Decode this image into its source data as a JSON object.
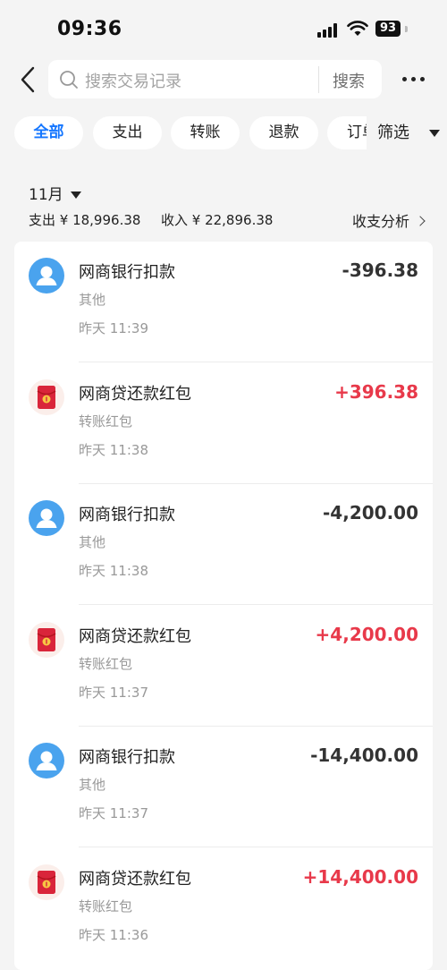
{
  "status_bar": {
    "time": "09:36",
    "battery": "93"
  },
  "header": {
    "search_placeholder": "搜索交易记录",
    "search_button": "搜索"
  },
  "tabs": [
    {
      "label": "全部",
      "active": true
    },
    {
      "label": "支出"
    },
    {
      "label": "转账"
    },
    {
      "label": "退款"
    },
    {
      "label": "订单"
    }
  ],
  "filter_label": "筛选",
  "summary": {
    "month": "11月",
    "expense": "支出 ¥ 18,996.38",
    "income": "收入 ¥ 22,896.38",
    "analysis": "收支分析"
  },
  "colors": {
    "accent": "#1677ff",
    "income": "#e8394a",
    "avatar_blue": "#4aa3ee",
    "envelope_red": "#d9253a"
  },
  "transactions": [
    {
      "title": "网商银行扣款",
      "category": "其他",
      "time": "昨天 11:39",
      "amount": "-396.38",
      "type": "expense",
      "icon": "person-avatar-icon"
    },
    {
      "title": "网商贷还款红包",
      "category": "转账红包",
      "time": "昨天 11:38",
      "amount": "+396.38",
      "type": "income",
      "icon": "red-envelope-icon"
    },
    {
      "title": "网商银行扣款",
      "category": "其他",
      "time": "昨天 11:38",
      "amount": "-4,200.00",
      "type": "expense",
      "icon": "person-avatar-icon"
    },
    {
      "title": "网商贷还款红包",
      "category": "转账红包",
      "time": "昨天 11:37",
      "amount": "+4,200.00",
      "type": "income",
      "icon": "red-envelope-icon"
    },
    {
      "title": "网商银行扣款",
      "category": "其他",
      "time": "昨天 11:37",
      "amount": "-14,400.00",
      "type": "expense",
      "icon": "person-avatar-icon"
    },
    {
      "title": "网商贷还款红包",
      "category": "转账红包",
      "time": "昨天 11:36",
      "amount": "+14,400.00",
      "type": "income",
      "icon": "red-envelope-icon"
    }
  ]
}
